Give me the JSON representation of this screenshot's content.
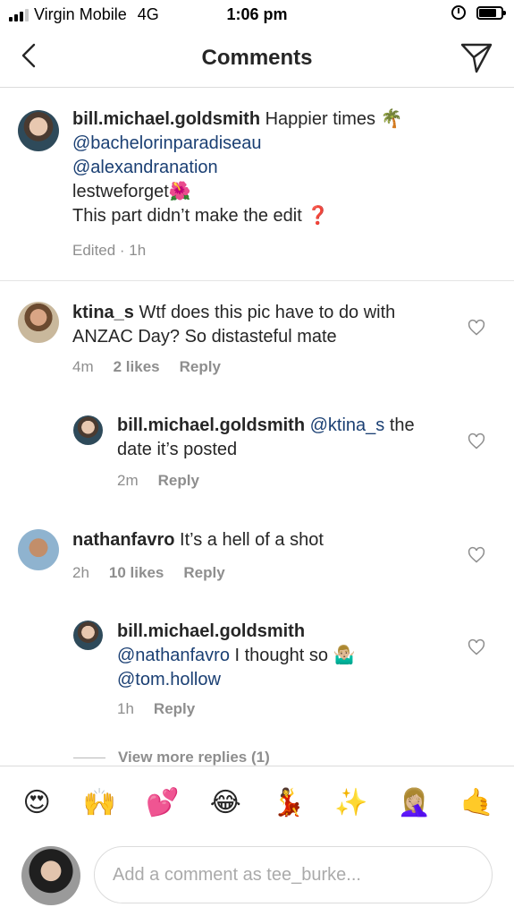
{
  "status_bar": {
    "carrier": "Virgin Mobile",
    "network": "4G",
    "time": "1:06 pm"
  },
  "nav": {
    "title": "Comments"
  },
  "caption": {
    "username": "bill.michael.goldsmith",
    "text": "Happier times",
    "emoji": "🌴",
    "mention1": "@bachelorinparadiseau",
    "mention2": "@alexandranation",
    "hashtag": "lestweforget",
    "hashtag_emoji": "🌺",
    "line4": "This part didn’t make the edit",
    "line4_emoji": "❓",
    "meta": "Edited · 1h"
  },
  "comments": [
    {
      "username": "ktina_s",
      "text": "Wtf does this pic have to do with ANZAC Day? So distasteful mate",
      "time": "4m",
      "likes": "2 likes",
      "reply": "Reply"
    },
    {
      "username": "bill.michael.goldsmith",
      "mention": "@ktina_s",
      "text": "the date it’s posted",
      "time": "2m",
      "reply": "Reply"
    },
    {
      "username": "nathanfavro",
      "text": "It’s a hell of a shot",
      "time": "2h",
      "likes": "10 likes",
      "reply": "Reply"
    },
    {
      "username": "bill.michael.goldsmith",
      "mention": "@nathanfavro",
      "text": "I thought so",
      "emoji": "🤷🏼‍♂️",
      "mention2": "@tom.hollow",
      "time": "1h",
      "reply": "Reply"
    }
  ],
  "view_more": "View more replies (1)",
  "emoji_bar": [
    "😍",
    "🙌",
    "💕",
    "😂",
    "💃",
    "✨",
    "🤦🏼‍♀️",
    "🤙"
  ],
  "composer": {
    "placeholder": "Add a comment as tee_burke..."
  },
  "colors": {
    "mention": "#1a3f73",
    "meta": "#8e8e8e",
    "divider": "#dbdbdb"
  },
  "icons": [
    "back-chevron-icon",
    "send-icon",
    "heart-icon",
    "signal-icon",
    "alarm-icon",
    "battery-icon"
  ]
}
